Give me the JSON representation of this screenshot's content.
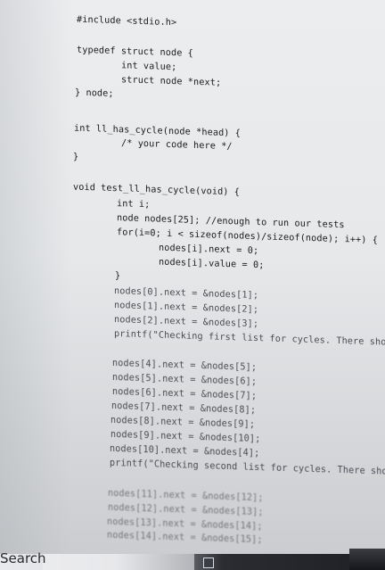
{
  "code_lines": [
    "#include <stdio.h>",
    "typedef struct node {",
    "int value;",
    "struct node *next;",
    "} node;",
    "int ll_has_cycle(node *head) {",
    "/* your code here */",
    "}",
    "void test_ll_has_cycle(void) {",
    "int i;",
    "node nodes[25]; //enough to run our tests",
    "for(i=0; i < sizeof(nodes)/sizeof(node); i++) {",
    "nodes[i].next = 0;",
    "nodes[i].value = 0;",
    "}",
    "nodes[0].next = &nodes[1];",
    "nodes[1].next = &nodes[2];",
    "nodes[2].next = &nodes[3];",
    "printf(\"Checking first list for cycles. There sho",
    "nodes[4].next = &nodes[5];",
    "nodes[5].next = &nodes[6];",
    "nodes[6].next = &nodes[7];",
    "nodes[7].next = &nodes[8];",
    "nodes[8].next = &nodes[9];",
    "nodes[9].next = &nodes[10];",
    "nodes[10].next = &nodes[4];",
    "printf(\"Checking second list for cycles. There shoul",
    "nodes[11].next = &nodes[12];",
    "nodes[12].next = &nodes[13];",
    "nodes[13].next = &nodes[14];",
    "nodes[14].next = &nodes[15];"
  ],
  "taskbar": {
    "search_label": "Search"
  },
  "colors": {
    "code_text": "#1b1b1b",
    "taskbar_dark": "#1e2026",
    "screen_bg": "#e6e8ea"
  }
}
